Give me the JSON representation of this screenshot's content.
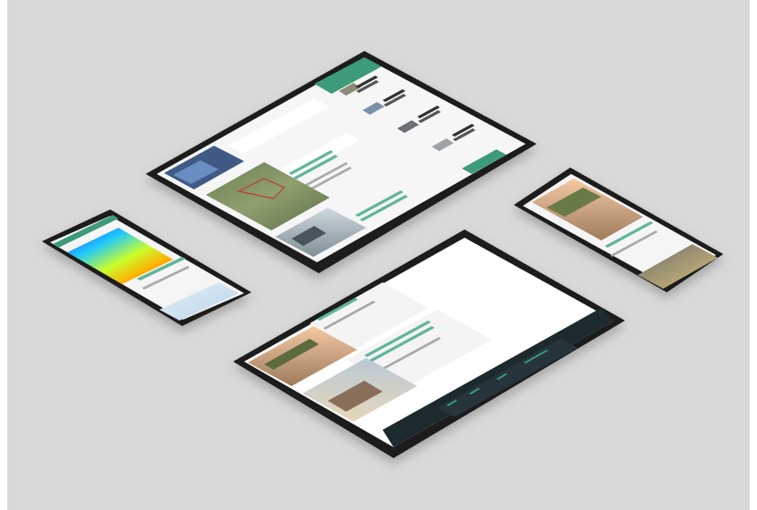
{
  "scene": {
    "description_tag": "",
    "colors": {
      "background": "#d9d9d9",
      "device_frame": "#1a1a1a",
      "screen_bg": "#f5f5f5",
      "accent_green": "#3d9a7a",
      "footer_dark": "#1f2a2e"
    }
  },
  "devices": [
    {
      "kind": "tablet",
      "label": "tablet-top"
    },
    {
      "kind": "tablet",
      "label": "tablet-bottom"
    },
    {
      "kind": "phone",
      "label": "phone-left"
    },
    {
      "kind": "phone",
      "label": "phone-right"
    }
  ]
}
